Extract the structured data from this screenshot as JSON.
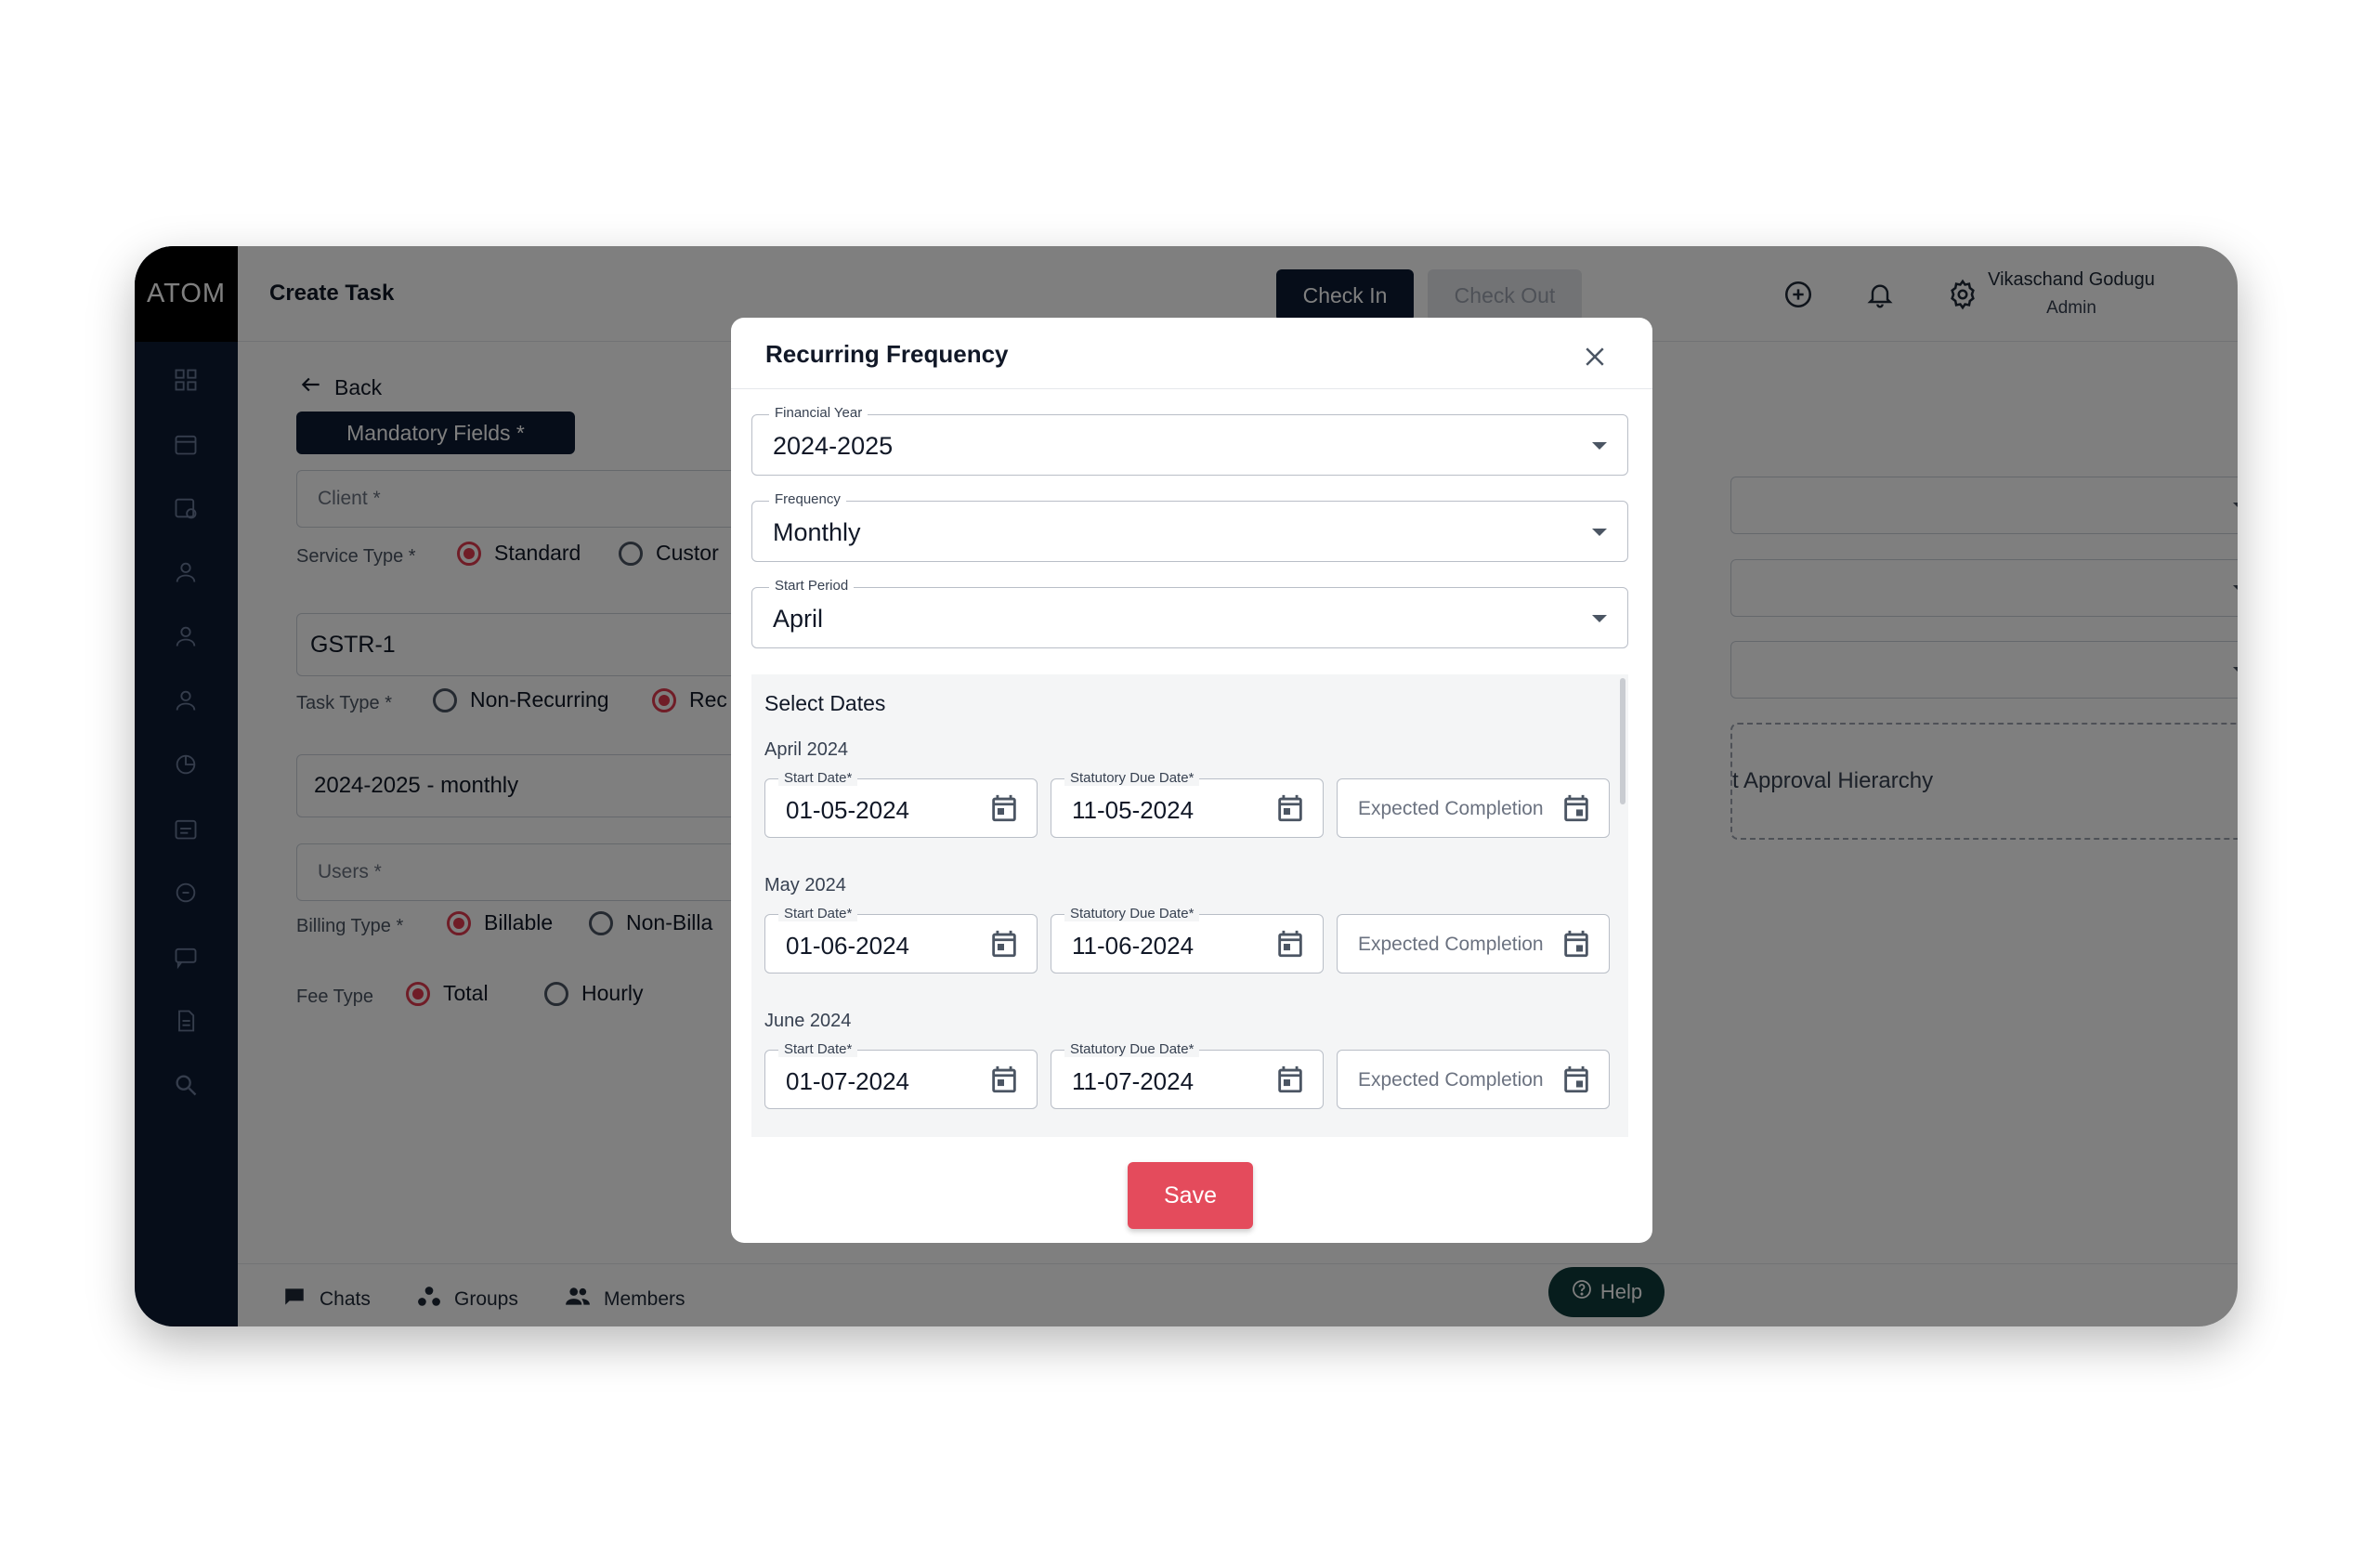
{
  "app": {
    "logo": "ATOM",
    "page_title": "Create Task"
  },
  "header": {
    "check_in": "Check In",
    "check_out": "Check Out",
    "user_name": "Vikaschand Godugu",
    "user_role": "Admin"
  },
  "form": {
    "back": "Back",
    "mandatory": "Mandatory Fields *",
    "client_placeholder": "Client *",
    "service_type_label": "Service Type *",
    "service_standard": "Standard",
    "service_custom": "Custor",
    "service_value": "GSTR-1",
    "task_type_label": "Task Type *",
    "task_nonrecurring": "Non-Recurring",
    "task_recurring": "Rec",
    "recurring_value": "2024-2025 - monthly",
    "users_placeholder": "Users *",
    "billing_type_label": "Billing Type *",
    "billing_billable": "Billable",
    "billing_nonbillable": "Non-Billa",
    "fee_type_label": "Fee Type",
    "fee_total": "Total",
    "fee_hourly": "Hourly",
    "approval": "t Approval Hierarchy"
  },
  "bottom": {
    "chats": "Chats",
    "groups": "Groups",
    "members": "Members",
    "help": "Help"
  },
  "modal": {
    "title": "Recurring Frequency",
    "financial_year_label": "Financial Year",
    "financial_year": "2024-2025",
    "frequency_label": "Frequency",
    "frequency": "Monthly",
    "start_period_label": "Start Period",
    "start_period": "April",
    "select_dates": "Select Dates",
    "start_date_label": "Start Date*",
    "due_date_label": "Statutory Due Date*",
    "expected_placeholder": "Expected Completion",
    "months": [
      {
        "label": "April 2024",
        "start": "01-05-2024",
        "due": "11-05-2024"
      },
      {
        "label": "May 2024",
        "start": "01-06-2024",
        "due": "11-06-2024"
      },
      {
        "label": "June 2024",
        "start": "01-07-2024",
        "due": "11-07-2024"
      }
    ],
    "save": "Save"
  },
  "colors": {
    "navy": "#0d1b33",
    "accent_red": "#e44b5c",
    "help_green": "#0f3b3b"
  }
}
